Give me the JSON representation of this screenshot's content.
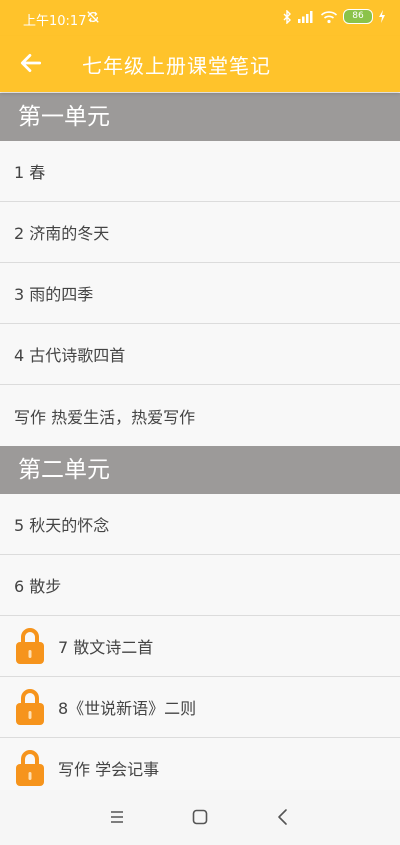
{
  "status_bar": {
    "time": "上午10:17",
    "battery": "86"
  },
  "header": {
    "title": "七年级上册课堂笔记"
  },
  "sections": [
    {
      "title": "第一单元",
      "items": [
        {
          "label": "1 春",
          "locked": false
        },
        {
          "label": "2 济南的冬天",
          "locked": false
        },
        {
          "label": "3 雨的四季",
          "locked": false
        },
        {
          "label": "4 古代诗歌四首",
          "locked": false
        },
        {
          "label": "写作 热爱生活，热爱写作",
          "locked": false
        }
      ]
    },
    {
      "title": "第二单元",
      "items": [
        {
          "label": "5 秋天的怀念",
          "locked": false
        },
        {
          "label": "6 散步",
          "locked": false
        },
        {
          "label": "7 散文诗二首",
          "locked": true
        },
        {
          "label": "8《世说新语》二则",
          "locked": true
        },
        {
          "label": "写作 学会记事",
          "locked": true
        }
      ]
    }
  ],
  "colors": {
    "accent": "#ffc32b",
    "section_header": "#9c9a99",
    "lock": "#f6941c",
    "battery": "#8bc34a"
  },
  "icons": {
    "back": "arrow-left-icon",
    "lock": "lock-icon",
    "nav_menu": "menu-icon",
    "nav_home": "square-home-icon",
    "nav_back": "chevron-left-icon"
  }
}
